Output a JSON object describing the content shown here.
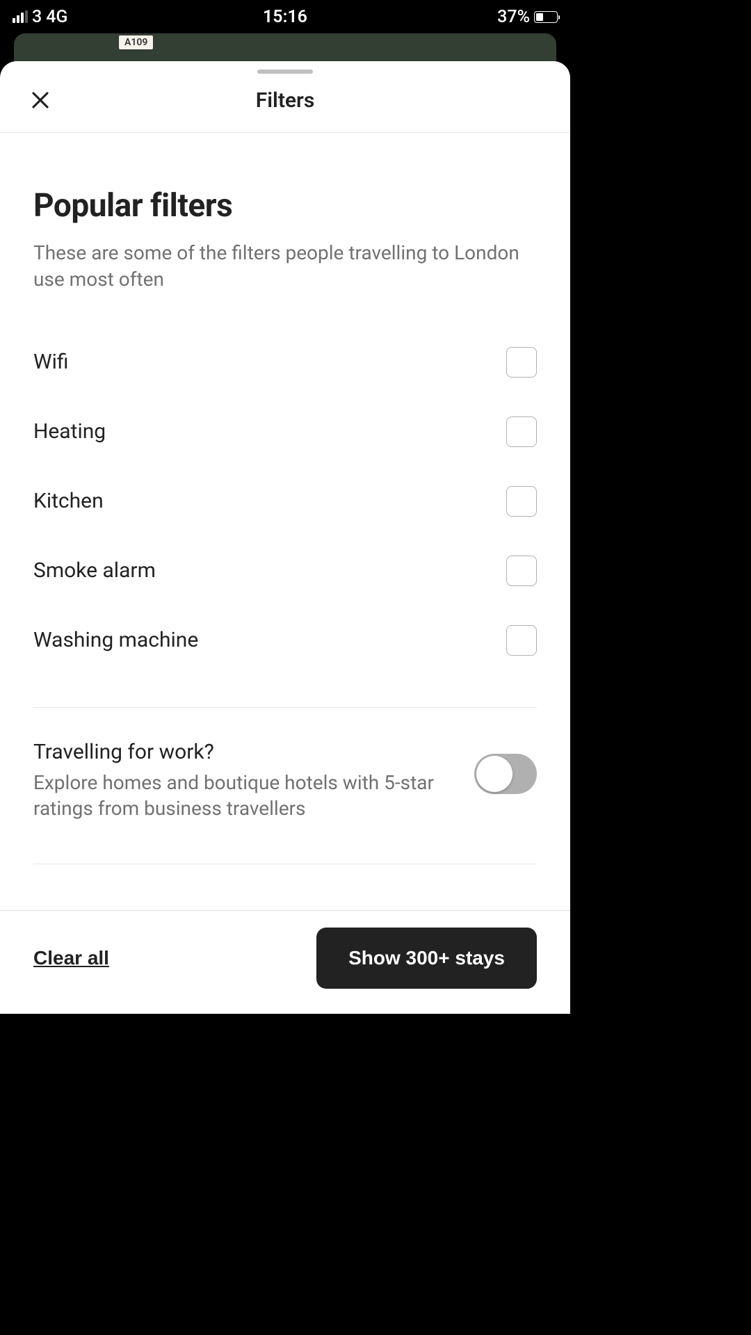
{
  "status": {
    "carrier": "3",
    "network": "4G",
    "time": "15:16",
    "battery": "37%"
  },
  "map": {
    "route": "A109"
  },
  "sheet": {
    "title": "Filters"
  },
  "popular": {
    "title": "Popular filters",
    "description": "These are some of the filters people travelling to London use most often",
    "items": [
      {
        "label": "Wifi"
      },
      {
        "label": "Heating"
      },
      {
        "label": "Kitchen"
      },
      {
        "label": "Smoke alarm"
      },
      {
        "label": "Washing machine"
      }
    ]
  },
  "work": {
    "title": "Travelling for work?",
    "description": "Explore homes and boutique hotels with 5-star ratings from business travellers"
  },
  "footer": {
    "clear": "Clear all",
    "show": "Show 300+ stays"
  }
}
